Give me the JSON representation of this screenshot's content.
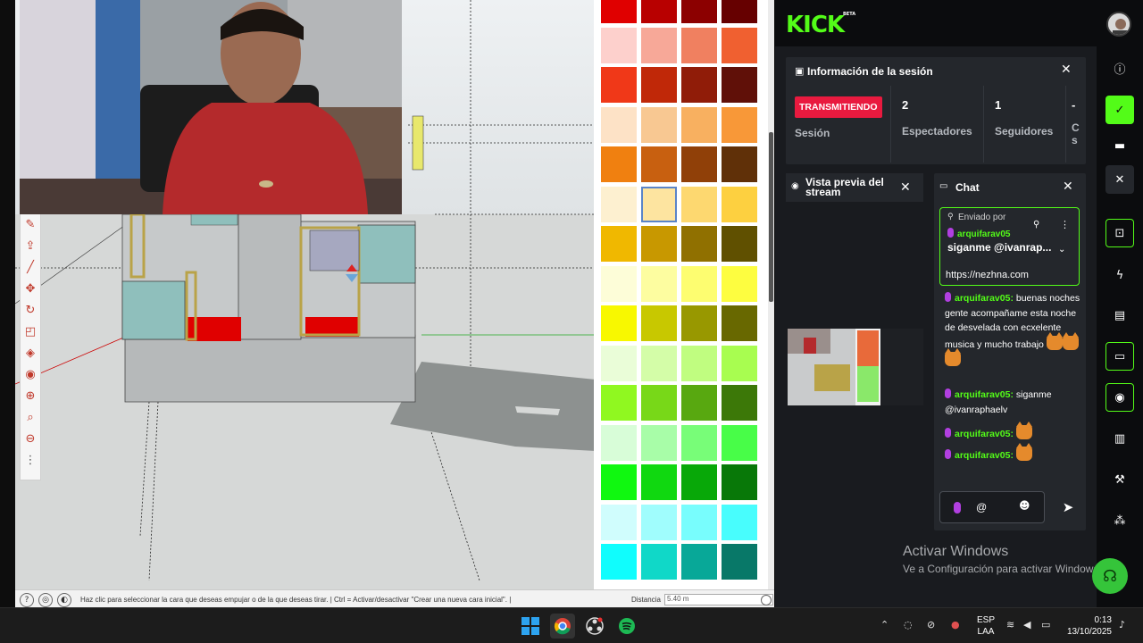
{
  "sketchup": {
    "status_message": "Haz clic para seleccionar la cara que deseas empujar o de la que deseas tirar. | Ctrl = Activar/desactivar \"Crear una nueva cara inicial\". |",
    "distance_label": "Distancia",
    "distance_value": "5.40 m",
    "tools": [
      "eraser-icon",
      "push-pull-icon",
      "line-icon",
      "move-icon",
      "rotate-icon",
      "scale-icon",
      "paint-bucket-icon",
      "tape-icon",
      "orbit-icon",
      "zoom-icon",
      "section-icon",
      "more-icon"
    ]
  },
  "palette": {
    "rows": [
      [
        "#e00000",
        "#b80000",
        "#8c0000",
        "#660000"
      ],
      [
        "#fdd0cc",
        "#f7a898",
        "#f08060",
        "#f06030"
      ],
      [
        "#f03818",
        "#c02808",
        "#901c08",
        "#601008"
      ],
      [
        "#fde2c6",
        "#f8c892",
        "#f8b060",
        "#f89838"
      ],
      [
        "#f08010",
        "#c86010",
        "#904008",
        "#603008"
      ],
      [
        "#fdf0d0",
        "#fde4a0",
        "#fdd870",
        "#fdd040"
      ],
      [
        "#f0b800",
        "#c89800",
        "#907000",
        "#605000"
      ],
      [
        "#fdfdd8",
        "#fdfda0",
        "#fdfd70",
        "#fdfd40"
      ],
      [
        "#f8f800",
        "#c8c800",
        "#989800",
        "#686800"
      ],
      [
        "#eafdd8",
        "#d4fda8",
        "#c0fd80",
        "#a8fd50"
      ],
      [
        "#90f820",
        "#78d818",
        "#58a810",
        "#3c7808"
      ],
      [
        "#d8fdd8",
        "#a8fda8",
        "#78fd78",
        "#48fd48"
      ],
      [
        "#10f810",
        "#10d810",
        "#08a808",
        "#087808"
      ],
      [
        "#d0fdfd",
        "#a0fdfd",
        "#78fdfd",
        "#48fdfd"
      ],
      [
        "#10fdfd",
        "#10d8c8",
        "#08a898",
        "#087868"
      ]
    ],
    "selected": "5-1"
  },
  "kick": {
    "logo": "KICK",
    "logo_badge": "BETA",
    "session": {
      "title": "Información de la sesión",
      "live_badge": "TRANSMITIENDO",
      "live_label": "Sesión",
      "stats": [
        {
          "num": "2",
          "label": "Espectadores"
        },
        {
          "num": "1",
          "label": "Seguidores"
        },
        {
          "num": "-",
          "label": "C s"
        }
      ]
    },
    "preview": {
      "title": "Vista previa del stream"
    },
    "chat": {
      "title": "Chat",
      "pinned_label": "Enviado por",
      "pinned_user": "arquifarav05",
      "pinned_message": "siganme @ivanrap...",
      "link": "https://nezhna.com",
      "messages": [
        {
          "user": "arquifarav05:",
          "text": "buenas noches gente acompañame esta noche de desvelada con ecxelente musica y mucho trabajo"
        },
        {
          "user": "arquifarav05:",
          "text": "siganme @ivanraphaelv"
        },
        {
          "user": "arquifarav05:",
          "text": ""
        },
        {
          "user": "arquifarav05:",
          "text": ""
        }
      ],
      "input_at": "@"
    }
  },
  "windows": {
    "activate_title": "Activar Windows",
    "activate_sub": "Ve a Configuración para activar Windows.",
    "lang_1": "ESP",
    "lang_2": "LAA",
    "time": "0:13",
    "date": "13/10/2025"
  }
}
